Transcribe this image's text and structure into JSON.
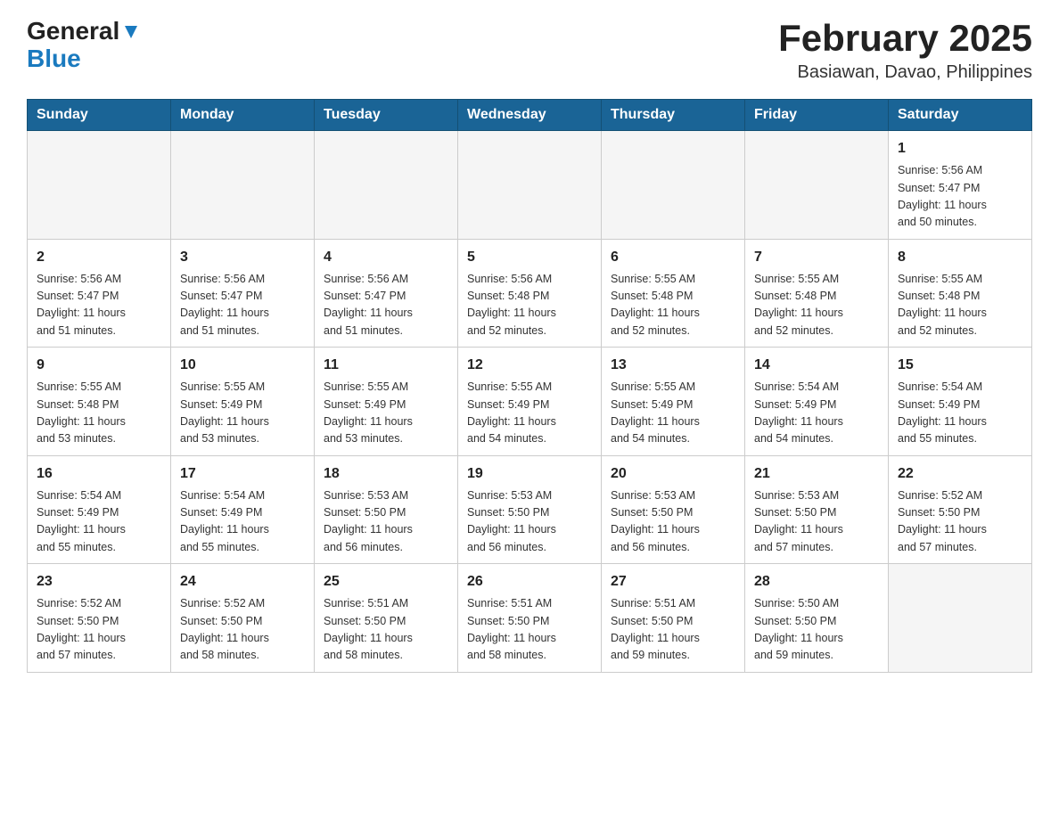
{
  "header": {
    "logo_general": "General",
    "logo_blue": "Blue",
    "month_title": "February 2025",
    "location": "Basiawan, Davao, Philippines"
  },
  "weekdays": [
    "Sunday",
    "Monday",
    "Tuesday",
    "Wednesday",
    "Thursday",
    "Friday",
    "Saturday"
  ],
  "weeks": [
    [
      {
        "day": "",
        "info": ""
      },
      {
        "day": "",
        "info": ""
      },
      {
        "day": "",
        "info": ""
      },
      {
        "day": "",
        "info": ""
      },
      {
        "day": "",
        "info": ""
      },
      {
        "day": "",
        "info": ""
      },
      {
        "day": "1",
        "info": "Sunrise: 5:56 AM\nSunset: 5:47 PM\nDaylight: 11 hours\nand 50 minutes."
      }
    ],
    [
      {
        "day": "2",
        "info": "Sunrise: 5:56 AM\nSunset: 5:47 PM\nDaylight: 11 hours\nand 51 minutes."
      },
      {
        "day": "3",
        "info": "Sunrise: 5:56 AM\nSunset: 5:47 PM\nDaylight: 11 hours\nand 51 minutes."
      },
      {
        "day": "4",
        "info": "Sunrise: 5:56 AM\nSunset: 5:47 PM\nDaylight: 11 hours\nand 51 minutes."
      },
      {
        "day": "5",
        "info": "Sunrise: 5:56 AM\nSunset: 5:48 PM\nDaylight: 11 hours\nand 52 minutes."
      },
      {
        "day": "6",
        "info": "Sunrise: 5:55 AM\nSunset: 5:48 PM\nDaylight: 11 hours\nand 52 minutes."
      },
      {
        "day": "7",
        "info": "Sunrise: 5:55 AM\nSunset: 5:48 PM\nDaylight: 11 hours\nand 52 minutes."
      },
      {
        "day": "8",
        "info": "Sunrise: 5:55 AM\nSunset: 5:48 PM\nDaylight: 11 hours\nand 52 minutes."
      }
    ],
    [
      {
        "day": "9",
        "info": "Sunrise: 5:55 AM\nSunset: 5:48 PM\nDaylight: 11 hours\nand 53 minutes."
      },
      {
        "day": "10",
        "info": "Sunrise: 5:55 AM\nSunset: 5:49 PM\nDaylight: 11 hours\nand 53 minutes."
      },
      {
        "day": "11",
        "info": "Sunrise: 5:55 AM\nSunset: 5:49 PM\nDaylight: 11 hours\nand 53 minutes."
      },
      {
        "day": "12",
        "info": "Sunrise: 5:55 AM\nSunset: 5:49 PM\nDaylight: 11 hours\nand 54 minutes."
      },
      {
        "day": "13",
        "info": "Sunrise: 5:55 AM\nSunset: 5:49 PM\nDaylight: 11 hours\nand 54 minutes."
      },
      {
        "day": "14",
        "info": "Sunrise: 5:54 AM\nSunset: 5:49 PM\nDaylight: 11 hours\nand 54 minutes."
      },
      {
        "day": "15",
        "info": "Sunrise: 5:54 AM\nSunset: 5:49 PM\nDaylight: 11 hours\nand 55 minutes."
      }
    ],
    [
      {
        "day": "16",
        "info": "Sunrise: 5:54 AM\nSunset: 5:49 PM\nDaylight: 11 hours\nand 55 minutes."
      },
      {
        "day": "17",
        "info": "Sunrise: 5:54 AM\nSunset: 5:49 PM\nDaylight: 11 hours\nand 55 minutes."
      },
      {
        "day": "18",
        "info": "Sunrise: 5:53 AM\nSunset: 5:50 PM\nDaylight: 11 hours\nand 56 minutes."
      },
      {
        "day": "19",
        "info": "Sunrise: 5:53 AM\nSunset: 5:50 PM\nDaylight: 11 hours\nand 56 minutes."
      },
      {
        "day": "20",
        "info": "Sunrise: 5:53 AM\nSunset: 5:50 PM\nDaylight: 11 hours\nand 56 minutes."
      },
      {
        "day": "21",
        "info": "Sunrise: 5:53 AM\nSunset: 5:50 PM\nDaylight: 11 hours\nand 57 minutes."
      },
      {
        "day": "22",
        "info": "Sunrise: 5:52 AM\nSunset: 5:50 PM\nDaylight: 11 hours\nand 57 minutes."
      }
    ],
    [
      {
        "day": "23",
        "info": "Sunrise: 5:52 AM\nSunset: 5:50 PM\nDaylight: 11 hours\nand 57 minutes."
      },
      {
        "day": "24",
        "info": "Sunrise: 5:52 AM\nSunset: 5:50 PM\nDaylight: 11 hours\nand 58 minutes."
      },
      {
        "day": "25",
        "info": "Sunrise: 5:51 AM\nSunset: 5:50 PM\nDaylight: 11 hours\nand 58 minutes."
      },
      {
        "day": "26",
        "info": "Sunrise: 5:51 AM\nSunset: 5:50 PM\nDaylight: 11 hours\nand 58 minutes."
      },
      {
        "day": "27",
        "info": "Sunrise: 5:51 AM\nSunset: 5:50 PM\nDaylight: 11 hours\nand 59 minutes."
      },
      {
        "day": "28",
        "info": "Sunrise: 5:50 AM\nSunset: 5:50 PM\nDaylight: 11 hours\nand 59 minutes."
      },
      {
        "day": "",
        "info": ""
      }
    ]
  ]
}
